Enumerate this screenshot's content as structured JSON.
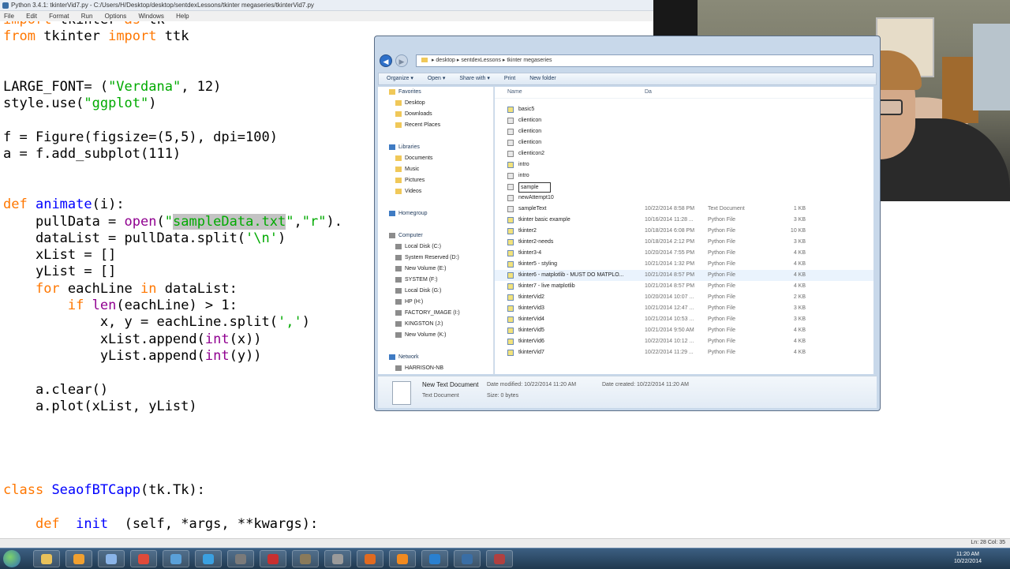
{
  "idle": {
    "title": "Python 3.4.1: tkinterVid7.py - C:/Users/H/Desktop/desktop/sentdexLessons/tkinter megaseries/tkinterVid7.py",
    "menu": [
      "File",
      "Edit",
      "Format",
      "Run",
      "Options",
      "Windows",
      "Help"
    ],
    "status_position": "Ln: 28 Col: 35"
  },
  "code_lines": [
    "import tkinter as tk",
    "from tkinter import ttk",
    "",
    "",
    "LARGE_FONT= (\"Verdana\", 12)",
    "style.use(\"ggplot\")",
    "",
    "f = Figure(figsize=(5,5), dpi=100)",
    "a = f.add_subplot(111)",
    "",
    "",
    "def animate(i):",
    "    pullData = open(\"sampleData.txt\",\"r\").",
    "    dataList = pullData.split('\\n')",
    "    xList = []",
    "    yList = []",
    "    for eachLine in dataList:",
    "        if len(eachLine) > 1:",
    "            x, y = eachLine.split(',')",
    "            xList.append(int(x))",
    "            yList.append(int(y))",
    "",
    "    a.clear()",
    "    a.plot(xList, yList)",
    "",
    "",
    "",
    "",
    "class SeaofBTCapp(tk.Tk):",
    "",
    "    def  init  (self, *args, **kwargs):"
  ],
  "explorer": {
    "breadcrumb": "▸  desktop  ▸  sentdexLessons  ▸  tkinter megaseries",
    "toolbar": [
      "Organize ▾",
      "Open ▾",
      "Share with ▾",
      "Print",
      "New folder"
    ],
    "nav": [
      {
        "label": "Favorites",
        "group": true,
        "icon": "star"
      },
      {
        "label": "Desktop",
        "icon": "folder"
      },
      {
        "label": "Downloads",
        "icon": "folder"
      },
      {
        "label": "Recent Places",
        "icon": "folder"
      },
      {
        "label": "",
        "icon": ""
      },
      {
        "label": "Libraries",
        "group": true,
        "icon": "library"
      },
      {
        "label": "Documents",
        "icon": "folder"
      },
      {
        "label": "Music",
        "icon": "folder"
      },
      {
        "label": "Pictures",
        "icon": "folder"
      },
      {
        "label": "Videos",
        "icon": "folder"
      },
      {
        "label": "",
        "icon": ""
      },
      {
        "label": "Homegroup",
        "group": true,
        "icon": "homegroup"
      },
      {
        "label": "",
        "icon": ""
      },
      {
        "label": "Computer",
        "group": true,
        "icon": "computer"
      },
      {
        "label": "Local Disk (C:)",
        "icon": "drive"
      },
      {
        "label": "System Reserved (D:)",
        "icon": "drive"
      },
      {
        "label": "New Volume (E:)",
        "icon": "drive"
      },
      {
        "label": "SYSTEM (F:)",
        "icon": "drive"
      },
      {
        "label": "Local Disk (G:)",
        "icon": "drive"
      },
      {
        "label": "HP (H:)",
        "icon": "drive"
      },
      {
        "label": "FACTORY_IMAGE (I:)",
        "icon": "drive"
      },
      {
        "label": "KINGSTON (J:)",
        "icon": "drive"
      },
      {
        "label": "New Volume (K:)",
        "icon": "drive"
      },
      {
        "label": "",
        "icon": ""
      },
      {
        "label": "Network",
        "group": true,
        "icon": "network"
      },
      {
        "label": "HARRISON-NB",
        "icon": "computer"
      }
    ],
    "column_name": "Name",
    "column_date": "Da",
    "files": [
      {
        "name": "basic5",
        "date": "",
        "type": "",
        "size": "",
        "py": true
      },
      {
        "name": "clienticon",
        "date": "",
        "type": "",
        "size": "",
        "py": false
      },
      {
        "name": "clienticon",
        "date": "",
        "type": "",
        "size": "",
        "py": false
      },
      {
        "name": "clienticon",
        "date": "",
        "type": "",
        "size": "",
        "py": false
      },
      {
        "name": "clienticon2",
        "date": "",
        "type": "",
        "size": "",
        "py": false
      },
      {
        "name": "intro",
        "date": "",
        "type": "",
        "size": "",
        "py": true
      },
      {
        "name": "intro",
        "date": "",
        "type": "",
        "size": "",
        "py": false
      },
      {
        "name": "sample",
        "date": "",
        "type": "",
        "size": "",
        "py": false,
        "rename": true
      },
      {
        "name": "newAttempt10",
        "date": "",
        "type": "",
        "size": "",
        "py": false
      },
      {
        "name": "sampleText",
        "date": "10/22/2014 8:58 PM",
        "type": "Text Document",
        "size": "1 KB",
        "py": false
      },
      {
        "name": "tkinter basic example",
        "date": "10/16/2014 11:28 ...",
        "type": "Python File",
        "size": "3 KB",
        "py": true
      },
      {
        "name": "tkinter2",
        "date": "10/18/2014 6:08 PM",
        "type": "Python File",
        "size": "10 KB",
        "py": true
      },
      {
        "name": "tkinter2-needs",
        "date": "10/18/2014 2:12 PM",
        "type": "Python File",
        "size": "3 KB",
        "py": true
      },
      {
        "name": "tkinter3-4",
        "date": "10/20/2014 7:55 PM",
        "type": "Python File",
        "size": "4 KB",
        "py": true
      },
      {
        "name": "tkinter5 - styling",
        "date": "10/21/2014 1:32 PM",
        "type": "Python File",
        "size": "4 KB",
        "py": true
      },
      {
        "name": "tkinter6 - matplotlib - MUST DO MATPLO...",
        "date": "10/21/2014 8:57 PM",
        "type": "Python File",
        "size": "4 KB",
        "py": true,
        "hl": true
      },
      {
        "name": "tkinter7 - live matplotlib",
        "date": "10/21/2014 8:57 PM",
        "type": "Python File",
        "size": "4 KB",
        "py": true
      },
      {
        "name": "tkinterVid2",
        "date": "10/20/2014 10:07 ...",
        "type": "Python File",
        "size": "2 KB",
        "py": true
      },
      {
        "name": "tkinterVid3",
        "date": "10/21/2014 12:47 ...",
        "type": "Python File",
        "size": "3 KB",
        "py": true
      },
      {
        "name": "tkinterVid4",
        "date": "10/21/2014 10:53 ...",
        "type": "Python File",
        "size": "3 KB",
        "py": true
      },
      {
        "name": "tkinterVid5",
        "date": "10/21/2014 9:50 AM",
        "type": "Python File",
        "size": "4 KB",
        "py": true
      },
      {
        "name": "tkinterVid6",
        "date": "10/22/2014 10:12 ...",
        "type": "Python File",
        "size": "4 KB",
        "py": true
      },
      {
        "name": "tkinterVid7",
        "date": "10/22/2014 11:29 ...",
        "type": "Python File",
        "size": "4 KB",
        "py": true
      }
    ],
    "details": {
      "name": "New Text Document",
      "type": "Text Document",
      "modified": "Date modified: 10/22/2014 11:20 AM",
      "size": "Size: 0 bytes",
      "created": "Date created: 10/22/2014 11:20 AM"
    }
  },
  "taskbar": {
    "apps": [
      "explorer",
      "media",
      "notepad",
      "chrome",
      "paint",
      "snipping",
      "python",
      "filezilla",
      "gimp",
      "vm",
      "firefox",
      "player",
      "vpn",
      "python-idle",
      "tool"
    ],
    "app_colors": [
      "#e8c15a",
      "#f0a030",
      "#8ab4e8",
      "#e04a3a",
      "#5aa0d8",
      "#3aa0e0",
      "#7a7a7a",
      "#c83030",
      "#8a7a5a",
      "#9a9a9a",
      "#e06a20",
      "#f08a20",
      "#2a80d0",
      "#3a6ea5",
      "#b04040"
    ],
    "time": "11:20 AM",
    "date": "10/22/2014"
  }
}
